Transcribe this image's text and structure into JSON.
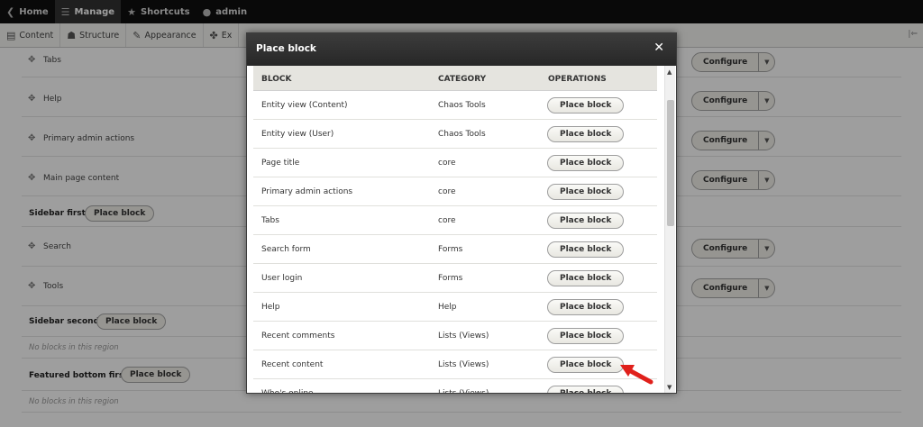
{
  "toolbar": {
    "home": "Home",
    "manage": "Manage",
    "shortcuts": "Shortcuts",
    "user": "admin"
  },
  "tray": {
    "items": [
      "Content",
      "Structure",
      "Appearance",
      "Ex"
    ]
  },
  "background": {
    "rows": [
      {
        "label": "Tabs",
        "configure": "Configure"
      },
      {
        "label": "Help",
        "configure": "Configure"
      },
      {
        "label": "Primary admin actions",
        "configure": "Configure"
      },
      {
        "label": "Main page content",
        "configure": "Configure"
      },
      {
        "label": "Search",
        "configure": "Configure"
      },
      {
        "label": "Tools",
        "configure": "Configure"
      }
    ],
    "regions": {
      "sidebar_first": "Sidebar first",
      "sidebar_second": "Sidebar second",
      "featured_bottom_first": "Featured bottom first",
      "place_block": "Place block",
      "no_blocks": "No blocks in this region"
    }
  },
  "dialog": {
    "title": "Place block",
    "close": "✕",
    "columns": [
      "BLOCK",
      "CATEGORY",
      "OPERATIONS"
    ],
    "button_label": "Place block",
    "rows": [
      {
        "block": "Entity view (Content)",
        "category": "Chaos Tools"
      },
      {
        "block": "Entity view (User)",
        "category": "Chaos Tools"
      },
      {
        "block": "Page title",
        "category": "core"
      },
      {
        "block": "Primary admin actions",
        "category": "core"
      },
      {
        "block": "Tabs",
        "category": "core"
      },
      {
        "block": "Search form",
        "category": "Forms"
      },
      {
        "block": "User login",
        "category": "Forms"
      },
      {
        "block": "Help",
        "category": "Help"
      },
      {
        "block": "Recent comments",
        "category": "Lists (Views)"
      },
      {
        "block": "Recent content",
        "category": "Lists (Views)"
      },
      {
        "block": "Who's online",
        "category": "Lists (Views)"
      }
    ]
  },
  "annotation": {
    "color": "#e0201b",
    "target": "Recent content"
  }
}
